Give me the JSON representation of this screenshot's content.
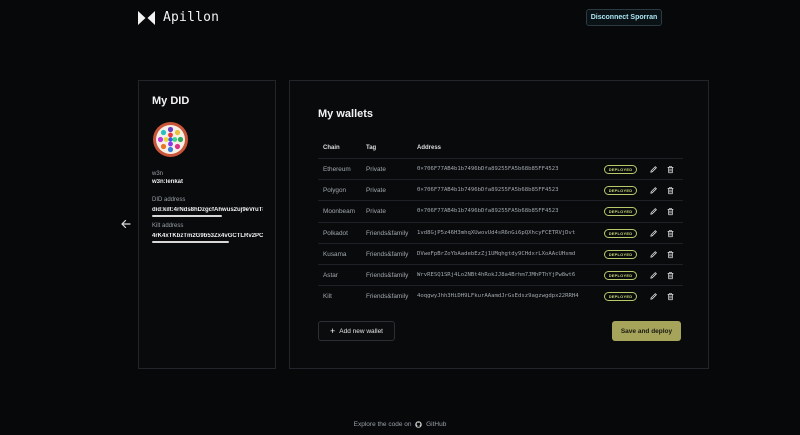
{
  "header": {
    "logo_text": "Apillon",
    "connect_label": "Disconnect Sporran"
  },
  "did": {
    "title": "My DID",
    "name_label": "w3n",
    "name_value": "w3n:lenkat",
    "did_label": "DID address",
    "did_value": "did:kilt:4rNds8hDzgcfAhwus2uj9eVruT8Vq",
    "kilt_label": "Kilt address",
    "kilt_value": "4rK4xTKbzTm2G9b53Zx4vGCTLRv2PCaqc"
  },
  "wallets": {
    "title": "My wallets",
    "columns": [
      "Chain",
      "Tag",
      "Address"
    ],
    "rows": [
      {
        "chain": "Ethereum",
        "tag": "Private",
        "address": "0×706F77AB4b1b7496bDfa89255FA5b68b85FF4523",
        "status": "DEPLOYED"
      },
      {
        "chain": "Polygon",
        "tag": "Private",
        "address": "0×706F77AB4b1b7496bDfa89255FA5b68b85FF4523",
        "status": "DEPLOYED"
      },
      {
        "chain": "Moonbeam",
        "tag": "Private",
        "address": "0×706F77AB4b1b7496bDfa89255FA5b68b85FF4523",
        "status": "DEPLOYED"
      },
      {
        "chain": "Polkadot",
        "tag": "Friends&family",
        "address": "1vd8GjP5z46H3mhqXUwovUd4sR6nGi6pQXhcyFCETRVjDvt",
        "status": "DEPLOYED"
      },
      {
        "chain": "Kusama",
        "tag": "Friends&family",
        "address": "DVweFpBrZoYbAadebEzZj1UMqhgtdy9CHdxrLXoAAcUHsmd",
        "status": "DEPLOYED"
      },
      {
        "chain": "Astar",
        "tag": "Friends&family",
        "address": "WrvRESQ1SRj4Lo2NBt4hRokJJ8a4Brhm7JMhPThYjPw8wt6",
        "status": "DEPLOYED"
      },
      {
        "chain": "Kilt",
        "tag": "Friends&family",
        "address": "4oqgwyJhh3HiDH9LFkurAAamdJrGsEdsz9agzwgdpx22RRH4",
        "status": "DEPLOYED"
      }
    ],
    "add_label": "Add new wallet",
    "save_label": "Save and deploy"
  },
  "footer": {
    "text": "Explore the code on",
    "link": "GitHub"
  },
  "colors": {
    "background": "#06080a",
    "accent_button": "#a6a35a",
    "badge": "#c9dd7a",
    "connect_text": "#a9e6f4"
  },
  "icons": [
    "apillon-logo-icon",
    "back-arrow-icon",
    "edit-pencil-icon",
    "trash-icon",
    "plus-icon",
    "github-icon"
  ]
}
